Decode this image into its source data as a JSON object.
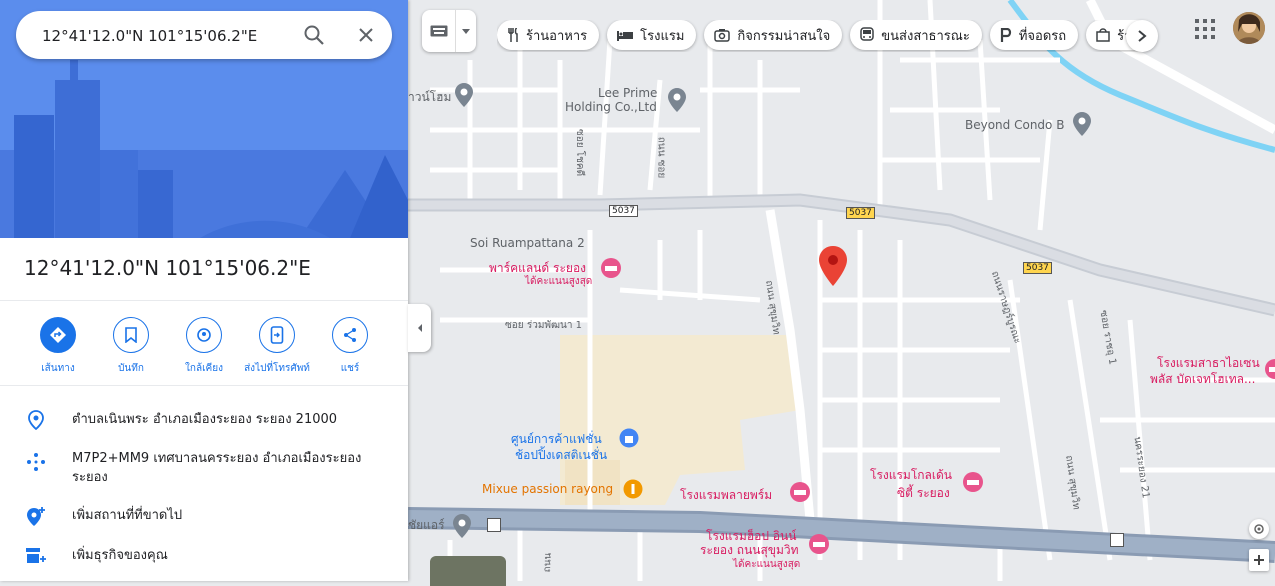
{
  "search": {
    "query": "12°41'12.0\"N 101°15'06.2\"E"
  },
  "place": {
    "title": "12°41'12.0\"N 101°15'06.2\"E"
  },
  "actions": [
    {
      "label": "เส้นทาง",
      "icon": "directions-icon"
    },
    {
      "label": "บันทึก",
      "icon": "bookmark-icon"
    },
    {
      "label": "ใกล้เคียง",
      "icon": "nearby-icon"
    },
    {
      "label": "ส่งไปที่โทรศัพท์",
      "icon": "send-to-phone-icon"
    },
    {
      "label": "แชร์",
      "icon": "share-icon"
    }
  ],
  "info": [
    {
      "text": "ตำบลเนินพระ อำเภอเมืองระยอง ระยอง 21000",
      "icon": "location-pin-icon"
    },
    {
      "text": "M7P2+MM9 เทศบาลนครระยอง อำเภอเมืองระยอง ระยอง",
      "icon": "plus-code-icon"
    },
    {
      "text": "เพิ่มสถานที่ที่ขาดไป",
      "icon": "add-place-icon"
    },
    {
      "text": "เพิ่มธุรกิจของคุณ",
      "icon": "add-business-icon"
    }
  ],
  "chips": [
    {
      "label": "ร้านอาหาร",
      "icon": "restaurant-icon"
    },
    {
      "label": "โรงแรม",
      "icon": "hotel-icon"
    },
    {
      "label": "กิจกรรมน่าสนใจ",
      "icon": "camera-icon"
    },
    {
      "label": "ขนส่งสาธารณะ",
      "icon": "transit-icon"
    },
    {
      "label": "ที่จอดรถ",
      "icon": "parking-icon"
    },
    {
      "label": "ร้าน",
      "icon": "shopping-icon"
    }
  ],
  "map_labels": {
    "lee_prime_1": "Lee Prime",
    "lee_prime_2": "Holding Co.,Ltd",
    "town_home": "าวน์โฮม",
    "beyond": "Beyond Condo B",
    "soi_ruam": "Soi Ruampattana 2",
    "park_land_1": "พาร์คแลนด์ ระยอง",
    "park_land_2": "ได้คะแนนสูงสุด",
    "soi_ruam_thai": "ซอย ร่วมพัฒนา 1",
    "fashion_1": "ศูนย์การค้าแฟชั่น",
    "fashion_2": "ช้อปปิ้งเดสติเนชั่น",
    "mixue": "Mixue passion rayong",
    "plai_palm": "โรงแรมพลายพร์ม",
    "golden_1": "โรงแรมโกลเด้น",
    "golden_2": "ซิตี้ ระยอง",
    "sathai_1": "โรงแรมสาธาไอเซน",
    "sathai_2": "พลัส บัดเจทโฮเทล...",
    "hop_inn_1": "โรงแรมฮ็อป อินน์",
    "hop_inn_2": "ระยอง ถนนสุขุมวิท",
    "hop_inn_3": "ได้คะแนนสูงสุด",
    "chai_air": "ชัยแอร์",
    "route_5037a": "5037",
    "route_5037b": "5037",
    "route_5037c": "5037",
    "road_a": "ซอย โชคดี",
    "road_b": "ถนน ซอย",
    "road_c": "ถนนราษฎร์บูรณะ",
    "road_d": "ซอย ราชอุ 1",
    "road_e": "ถนน สุขุมวิท",
    "road_f": "นครระยอง 21",
    "road_g": "ถนน สุขุมวิท",
    "road_h": "ถนน"
  },
  "colors": {
    "accent": "#1a73e8",
    "marker": "#ea4335",
    "hero": "#4f7fe6"
  }
}
